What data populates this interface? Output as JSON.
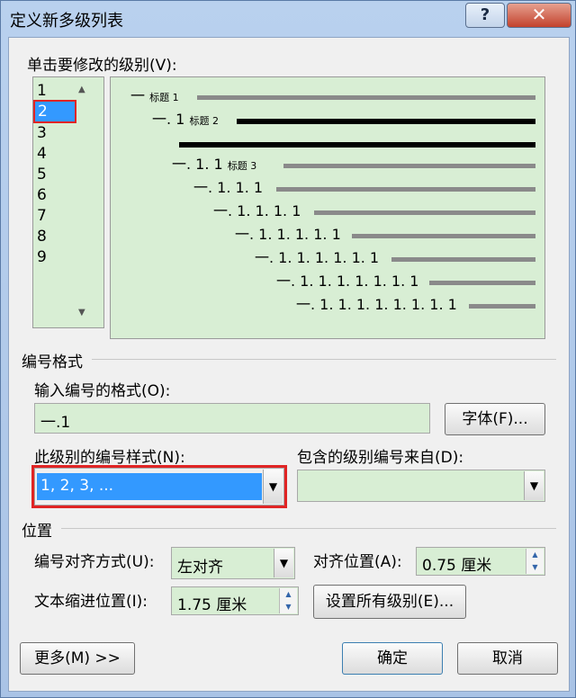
{
  "window": {
    "title": "定义新多级列表",
    "help": "?",
    "close": "✕"
  },
  "levels": {
    "label": "单击要修改的级别(V):",
    "items": [
      "1",
      "2",
      "3",
      "4",
      "5",
      "6",
      "7",
      "8",
      "9"
    ],
    "selected_index": 1
  },
  "preview": {
    "rows": [
      {
        "prefix": "一",
        "caption": "标题 1"
      },
      {
        "prefix": "一. 1",
        "caption": "标题 2"
      },
      {
        "prefix": "一. 1. 1",
        "caption": "标题 3"
      },
      {
        "prefix": "一. 1. 1. 1",
        "caption": ""
      },
      {
        "prefix": "一. 1. 1. 1. 1",
        "caption": ""
      },
      {
        "prefix": "一. 1. 1. 1. 1. 1",
        "caption": ""
      },
      {
        "prefix": "一. 1. 1. 1. 1. 1. 1",
        "caption": ""
      },
      {
        "prefix": "一. 1. 1. 1. 1. 1. 1. 1",
        "caption": ""
      },
      {
        "prefix": "一. 1. 1. 1. 1. 1. 1. 1. 1",
        "caption": ""
      }
    ]
  },
  "number_format": {
    "group_label": "编号格式",
    "format_label": "输入编号的格式(O):",
    "format_value": "一.1",
    "font_button": "字体(F)...",
    "style_label": "此级别的编号样式(N):",
    "style_value": "1, 2, 3, ...",
    "include_label": "包含的级别编号来自(D):",
    "include_value": ""
  },
  "position": {
    "group_label": "位置",
    "align_label": "编号对齐方式(U):",
    "align_value": "左对齐",
    "align_at_label": "对齐位置(A):",
    "align_at_value": "0.75 厘米",
    "indent_label": "文本缩进位置(I):",
    "indent_value": "1.75 厘米",
    "set_all_button": "设置所有级别(E)..."
  },
  "footer": {
    "more_button": "更多(M) >>",
    "ok_button": "确定",
    "cancel_button": "取消"
  },
  "colors": {
    "field_bg": "#d8eed4",
    "selection": "#3399ff",
    "highlight_box": "#e02424"
  }
}
